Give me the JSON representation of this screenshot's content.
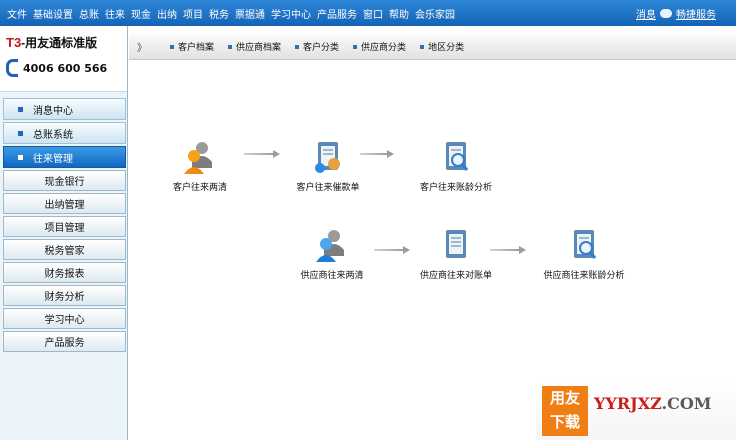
{
  "menu": {
    "items": [
      "文件",
      "基础设置",
      "总账",
      "往来",
      "现金",
      "出纳",
      "项目",
      "税务",
      "票据通",
      "学习中心",
      "产品服务",
      "窗口",
      "帮助",
      "会乐家园"
    ],
    "right_links": [
      "消息",
      "畅捷服务"
    ]
  },
  "brand": {
    "title_prefix": "T3",
    "title_rest": "-用友通标准版",
    "phone": "4006 600 566"
  },
  "sidebar": {
    "sections": [
      {
        "label": "消息中心",
        "active": false
      },
      {
        "label": "总账系统",
        "active": false
      },
      {
        "label": "往来管理",
        "active": true
      }
    ],
    "subitems": [
      "现金银行",
      "出纳管理",
      "项目管理",
      "税务管家",
      "财务报表",
      "财务分析",
      "学习中心",
      "产品服务"
    ]
  },
  "topbar": {
    "chevron": "》",
    "tabs": [
      "客户档案",
      "供应商档案",
      "客户分类",
      "供应商分类",
      "地区分类"
    ]
  },
  "flow": {
    "row1": [
      "客户往来两清",
      "客户往来催款单",
      "客户往来账龄分析"
    ],
    "row2": [
      "供应商往来两清",
      "供应商往来对账单",
      "供应商往来账龄分析"
    ]
  },
  "watermark": {
    "box_line1": "用友",
    "box_line2": "下载",
    "site_hi": "YYRJXZ",
    "site_tail": ".COM"
  },
  "colors": {
    "menubar": "#1a6fc4",
    "active_nav": "#1a75d0",
    "logo_orange": "#f07e14",
    "site_red": "#cc1d1d"
  }
}
